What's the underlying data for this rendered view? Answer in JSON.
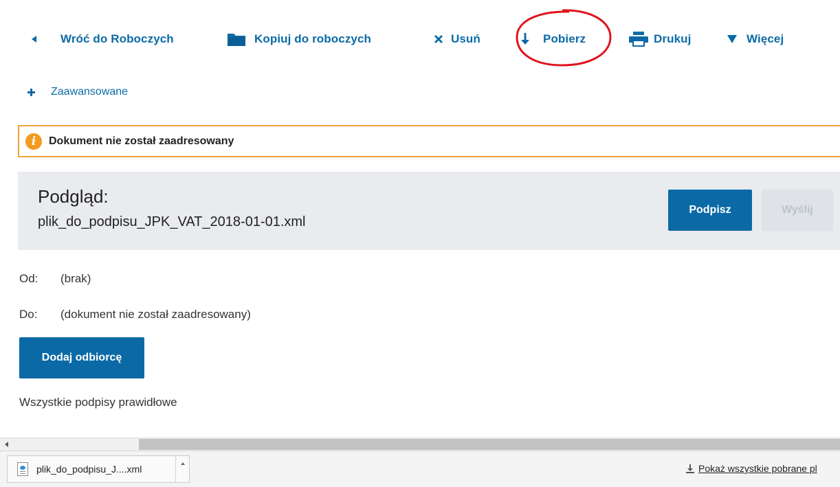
{
  "toolbar": {
    "back_label": "Wróć do Roboczych",
    "copy_label": "Kopiuj do roboczych",
    "delete_label": "Usuń",
    "download_label": "Pobierz",
    "print_label": "Drukuj",
    "more_label": "Więcej",
    "accent_color": "#0b6aa6",
    "highlight_color": "#e0141e",
    "icons": [
      "back-arrow-icon",
      "folder-icon",
      "close-icon",
      "download-arrow-icon",
      "printer-icon",
      "triangle-down-icon"
    ]
  },
  "advanced": {
    "label": "Zaawansowane",
    "icon": "plus-icon"
  },
  "alert": {
    "text": "Dokument nie został zaadresowany",
    "icon": "info-icon",
    "border_color": "#f0a23a"
  },
  "preview": {
    "title": "Podgląd:",
    "filename": "plik_do_podpisu_JPK_VAT_2018-01-01.xml",
    "sign_label": "Podpisz",
    "send_label": "Wyślij"
  },
  "meta": {
    "from_label": "Od:",
    "from_value": "(brak)",
    "to_label": "Do:",
    "to_value": "(dokument nie został zaadresowany)"
  },
  "add_recipient_label": "Dodaj odbiorcę",
  "signature_status": "Wszystkie podpisy prawidłowe",
  "downloads": {
    "file_name": "plik_do_podpisu_J....xml",
    "show_all_label": "Pokaż wszystkie pobrane pl"
  }
}
